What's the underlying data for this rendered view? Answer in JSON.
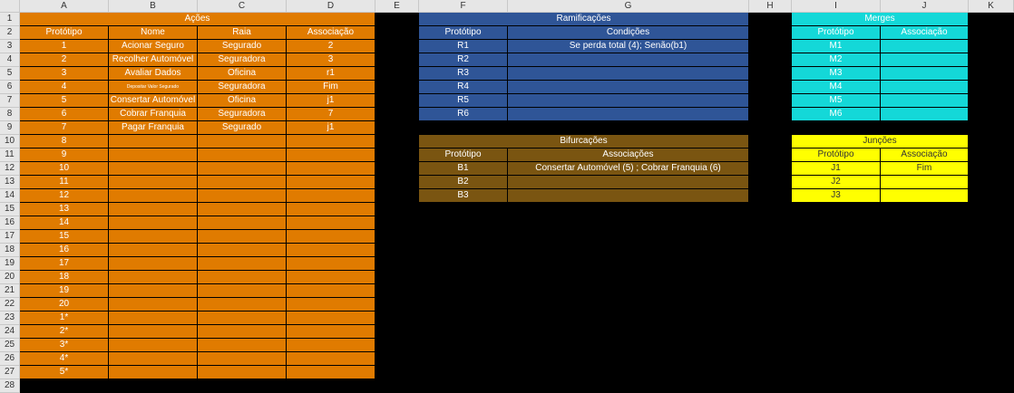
{
  "columns": [
    "A",
    "B",
    "C",
    "D",
    "E",
    "F",
    "G",
    "H",
    "I",
    "J",
    "K"
  ],
  "rows": [
    "1",
    "2",
    "3",
    "4",
    "5",
    "6",
    "7",
    "8",
    "9",
    "10",
    "11",
    "12",
    "13",
    "14",
    "15",
    "16",
    "17",
    "18",
    "19",
    "20",
    "21",
    "22",
    "23",
    "24",
    "25",
    "26",
    "27",
    "28"
  ],
  "acoes": {
    "title": "Ações",
    "headers": [
      "Protótipo",
      "Nome",
      "Raia",
      "Associação"
    ],
    "rows": [
      [
        "1",
        "Acionar Seguro",
        "Segurado",
        "2"
      ],
      [
        "2",
        "Recolher Automóvel",
        "Seguradora",
        "3"
      ],
      [
        "3",
        "Avaliar Dados",
        "Oficina",
        "r1"
      ],
      [
        "4",
        "Depositar Valor Segurado",
        "Seguradora",
        "Fim"
      ],
      [
        "5",
        "Consertar Automóvel",
        "Oficina",
        "j1"
      ],
      [
        "6",
        "Cobrar Franquia",
        "Seguradora",
        "7"
      ],
      [
        "7",
        "Pagar Franquia",
        "Segurado",
        "j1"
      ],
      [
        "8",
        "",
        "",
        ""
      ],
      [
        "9",
        "",
        "",
        ""
      ],
      [
        "10",
        "",
        "",
        ""
      ],
      [
        "11",
        "",
        "",
        ""
      ],
      [
        "12",
        "",
        "",
        ""
      ],
      [
        "13",
        "",
        "",
        ""
      ],
      [
        "14",
        "",
        "",
        ""
      ],
      [
        "15",
        "",
        "",
        ""
      ],
      [
        "16",
        "",
        "",
        ""
      ],
      [
        "17",
        "",
        "",
        ""
      ],
      [
        "18",
        "",
        "",
        ""
      ],
      [
        "19",
        "",
        "",
        ""
      ],
      [
        "20",
        "",
        "",
        ""
      ],
      [
        "1*",
        "",
        "",
        ""
      ],
      [
        "2*",
        "",
        "",
        ""
      ],
      [
        "3*",
        "",
        "",
        ""
      ],
      [
        "4*",
        "",
        "",
        ""
      ],
      [
        "5*",
        "",
        "",
        ""
      ]
    ]
  },
  "ramificacoes": {
    "title": "Ramificações",
    "headers": [
      "Protótipo",
      "Condições"
    ],
    "rows": [
      [
        "R1",
        "Se perda total (4); Senão(b1)"
      ],
      [
        "R2",
        ""
      ],
      [
        "R3",
        ""
      ],
      [
        "R4",
        ""
      ],
      [
        "R5",
        ""
      ],
      [
        "R6",
        ""
      ]
    ]
  },
  "bifurcacoes": {
    "title": "Bifurcações",
    "headers": [
      "Protótipo",
      "Associações"
    ],
    "rows": [
      [
        "B1",
        "Consertar Automóvel (5) ;  Cobrar Franquia (6)"
      ],
      [
        "B2",
        ""
      ],
      [
        "B3",
        ""
      ]
    ]
  },
  "merges": {
    "title": "Merges",
    "headers": [
      "Protótipo",
      "Associação"
    ],
    "rows": [
      [
        "M1",
        ""
      ],
      [
        "M2",
        ""
      ],
      [
        "M3",
        ""
      ],
      [
        "M4",
        ""
      ],
      [
        "M5",
        ""
      ],
      [
        "M6",
        ""
      ]
    ]
  },
  "juncoes": {
    "title": "Junções",
    "headers": [
      "Protótipo",
      "Associação"
    ],
    "rows": [
      [
        "J1",
        "Fim"
      ],
      [
        "J2",
        ""
      ],
      [
        "J3",
        ""
      ]
    ]
  },
  "colors": {
    "orange": "#e07b00",
    "blue": "#2f5597",
    "brown": "#7a5511",
    "cyan": "#14d8d8",
    "yellow": "#ffff00"
  }
}
